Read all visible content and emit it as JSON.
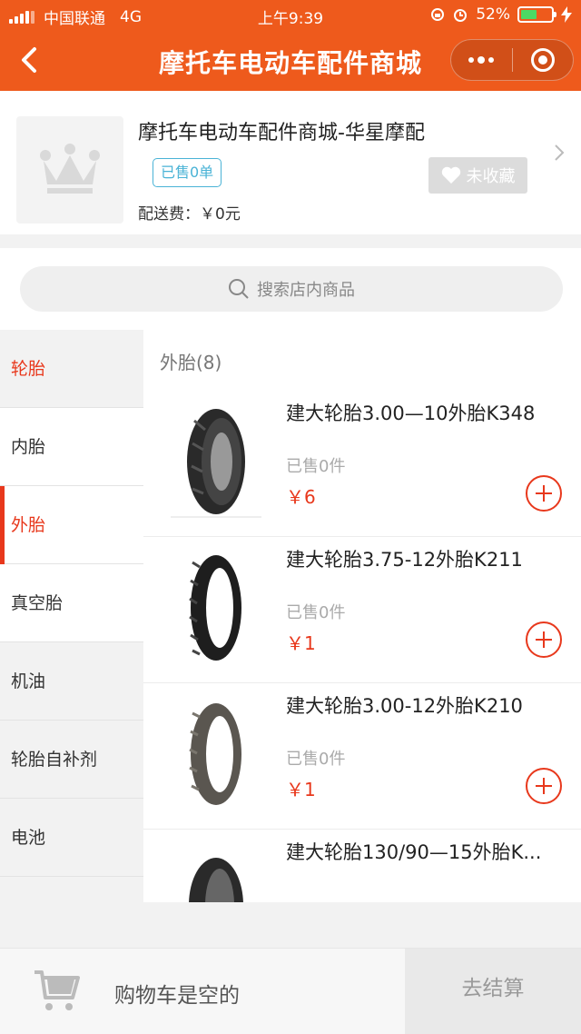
{
  "status_bar": {
    "carrier": "中国联通",
    "network": "4G",
    "time": "上午9:39",
    "battery_percent": "52%",
    "battery_level": 0.52
  },
  "nav": {
    "title": "摩托车电动车配件商城",
    "back_icon": "chevron-left-icon",
    "more_icon": "more-dots-icon",
    "close_icon": "target-circle-icon"
  },
  "store": {
    "name": "摩托车电动车配件商城-华星摩配",
    "sold_badge": "已售0单",
    "delivery_fee": "配送费：￥0元",
    "favorite_label": "未收藏",
    "logo_icon": "crown-icon"
  },
  "search": {
    "placeholder": "搜索店内商品"
  },
  "sidebar": {
    "categories": [
      {
        "label": "轮胎"
      },
      {
        "label": "内胎"
      },
      {
        "label": "外胎"
      },
      {
        "label": "真空胎"
      },
      {
        "label": "机油"
      },
      {
        "label": "轮胎自补剂"
      },
      {
        "label": "电池"
      }
    ]
  },
  "products": {
    "group_title": "外胎(8)",
    "items": [
      {
        "name": "建大轮胎3.00—10外胎K348",
        "sold": "已售0件",
        "price": "￥6"
      },
      {
        "name": "建大轮胎3.75-12外胎K211",
        "sold": "已售0件",
        "price": "￥1"
      },
      {
        "name": "建大轮胎3.00-12外胎K210",
        "sold": "已售0件",
        "price": "￥1"
      },
      {
        "name": "建大轮胎130/90—15外胎K...",
        "sold": "",
        "price": ""
      }
    ]
  },
  "cart": {
    "empty_text": "购物车是空的",
    "checkout_label": "去结算"
  },
  "colors": {
    "brand_orange": "#ee5a1c",
    "accent_red": "#e8381c",
    "badge_blue": "#4ab3d6"
  }
}
